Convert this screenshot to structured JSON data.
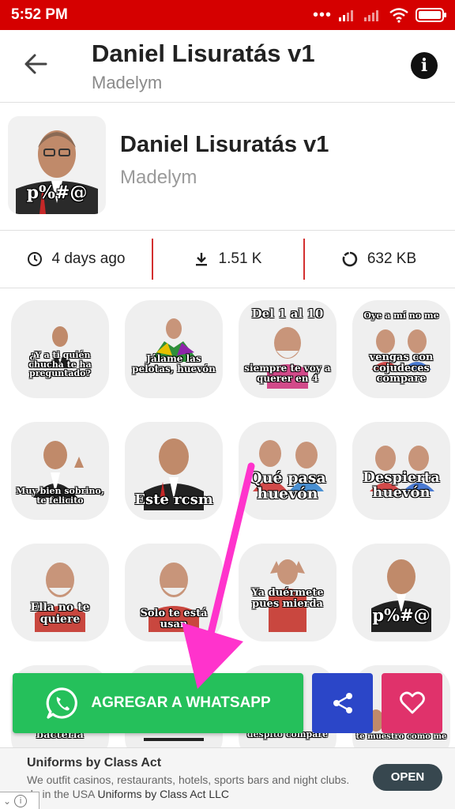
{
  "status_bar": {
    "time": "5:52 PM",
    "indicators": "•••",
    "icons": [
      "signal-icon",
      "signal-icon",
      "wifi-icon",
      "battery-icon"
    ],
    "color": "#d50000"
  },
  "app_bar": {
    "title": "Daniel Lisuratás v1",
    "subtitle": "Madelym",
    "info_glyph": "i"
  },
  "pack": {
    "title": "Daniel Lisuratás v1",
    "author": "Madelym",
    "tray_caption": "p%#@"
  },
  "stats": {
    "date": "4 days ago",
    "downloads": "1.51 K",
    "size": "632 KB",
    "divider_color": "#d32f2f"
  },
  "stickers": [
    {
      "caption": "¿Y a ti quién chucha te ha preguntado?"
    },
    {
      "caption": "Jálame las pelotas, huevón"
    },
    {
      "caption_top": "Del 1 al 10",
      "caption": "siempre te voy a querer en 4"
    },
    {
      "caption_top": "Oye a mí no me",
      "caption": "vengas con cojudeces compare"
    },
    {
      "caption": "Muy bien sobrino, te felicito"
    },
    {
      "caption": "Este rcsm"
    },
    {
      "caption": "Qué pasa huevón"
    },
    {
      "caption": "Despierta huevón"
    },
    {
      "caption": "Ella no te quiere"
    },
    {
      "caption": "Solo te está usan"
    },
    {
      "caption": "Ya duérmete pues mierda"
    },
    {
      "caption": "p%#@"
    },
    {
      "caption": "bacteria"
    },
    {
      "caption": ""
    },
    {
      "caption": "despito compare"
    },
    {
      "caption": "te muestro cómo me"
    }
  ],
  "actions": {
    "add_label": "AGREGAR A WHATSAPP",
    "add_color": "#25c05b",
    "share_color": "#2b46c8",
    "favorite_color": "#e0326b"
  },
  "annotation": {
    "arrow_color": "#ff33cc"
  },
  "ad": {
    "title": "Uniforms by Class Act",
    "text": "We outfit casinos, restaurants, hotels, sports bars and night clubs.",
    "line_prefix": "de in the USA",
    "advertiser": "Uniforms by Class Act LLC",
    "cta": "OPEN"
  }
}
